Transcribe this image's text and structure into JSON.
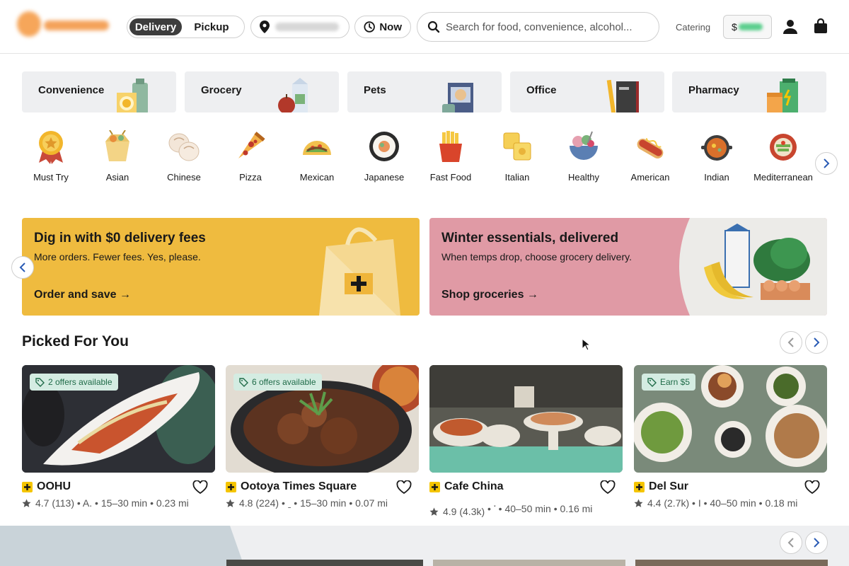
{
  "header": {
    "mode_delivery": "Delivery",
    "mode_pickup": "Pickup",
    "time": "Now",
    "search_placeholder": "Search for food, convenience, alcohol...",
    "catering": "Catering",
    "credits_prefix": "$"
  },
  "categories": [
    {
      "label": "Convenience"
    },
    {
      "label": "Grocery"
    },
    {
      "label": "Pets"
    },
    {
      "label": "Office"
    },
    {
      "label": "Pharmacy"
    }
  ],
  "cuisines": [
    {
      "label": "Must Try"
    },
    {
      "label": "Asian"
    },
    {
      "label": "Chinese"
    },
    {
      "label": "Pizza"
    },
    {
      "label": "Mexican"
    },
    {
      "label": "Japanese"
    },
    {
      "label": "Fast Food"
    },
    {
      "label": "Italian"
    },
    {
      "label": "Healthy"
    },
    {
      "label": "American"
    },
    {
      "label": "Indian"
    },
    {
      "label": "Mediterranean"
    }
  ],
  "promos": [
    {
      "title": "Dig in with $0 delivery fees",
      "subtitle": "More orders. Fewer fees. Yes, please.",
      "cta": "Order and save →"
    },
    {
      "title": "Winter essentials, delivered",
      "subtitle": "When temps drop, choose grocery delivery.",
      "cta": "Shop groceries →"
    }
  ],
  "section": {
    "title": "Picked For You"
  },
  "restaurants": [
    {
      "name": "OOHU",
      "offer": "2 offers available",
      "rating": "4.7 (113)",
      "details": "• A. • 15–30 min • 0.23 mi"
    },
    {
      "name": "Ootoya Times Square",
      "offer": "6 offers available",
      "rating": "4.8 (224)",
      "details": "• ˍ • 15–30 min • 0.07 mi"
    },
    {
      "name": "Cafe China",
      "offer": "",
      "rating": "4.9 (4.3k)",
      "details": "• ་ • 40–50 min • 0.16 mi"
    },
    {
      "name": "Del Sur",
      "offer": "Earn $5",
      "rating": "4.4 (2.7k)",
      "details": "• I • 40–50 min • 0.18 mi"
    }
  ],
  "colors": {
    "promo_yellow": "#efbb3f",
    "promo_pink": "#e09aa5",
    "offer_bg": "#d4ece2",
    "dashpass_yellow": "#f5c500"
  }
}
